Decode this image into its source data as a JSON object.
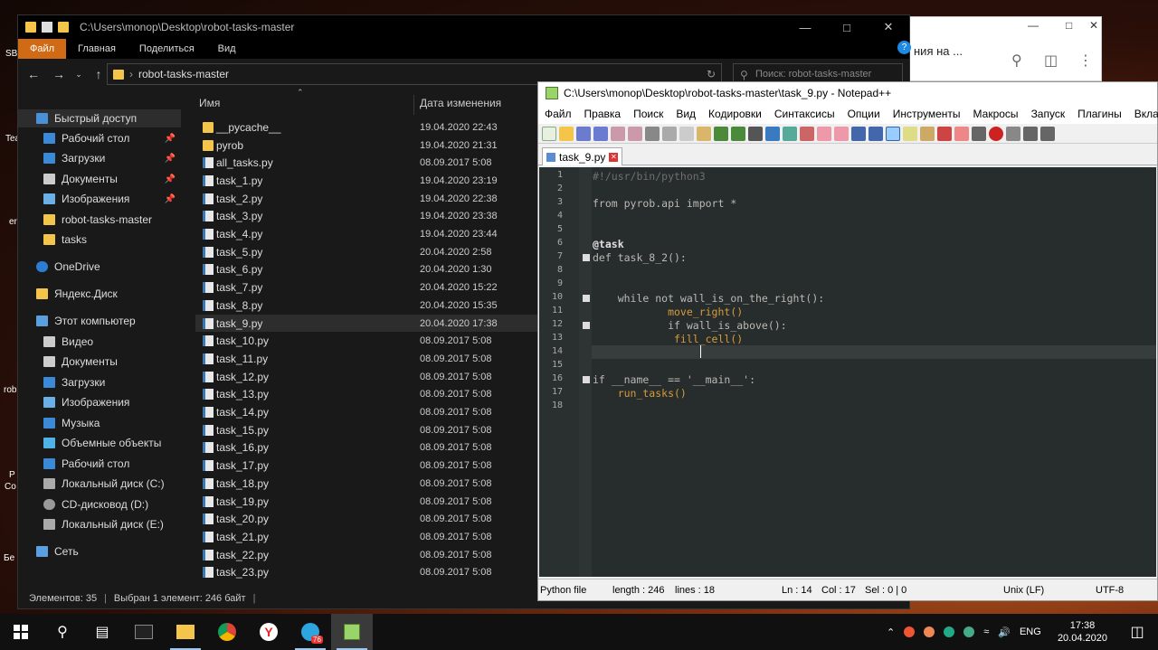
{
  "desktop": {
    "labels": [
      "SB",
      "Tea",
      "er",
      "rob",
      "P",
      "Co",
      "Бе"
    ]
  },
  "browser": {
    "title_fragment": "ния на ..."
  },
  "explorer": {
    "path": "C:\\Users\\monop\\Desktop\\robot-tasks-master",
    "ribbon_tabs": [
      "Файл",
      "Главная",
      "Поделиться",
      "Вид"
    ],
    "breadcrumb": "robot-tasks-master",
    "search_placeholder": "Поиск: robot-tasks-master",
    "nav_items": [
      {
        "label": "Быстрый доступ",
        "pinned": false
      },
      {
        "label": "Рабочий стол",
        "pinned": true
      },
      {
        "label": "Загрузки",
        "pinned": true
      },
      {
        "label": "Документы",
        "pinned": true
      },
      {
        "label": "Изображения",
        "pinned": true
      },
      {
        "label": "robot-tasks-master",
        "pinned": false
      },
      {
        "label": "tasks",
        "pinned": false
      },
      {
        "label": "OneDrive",
        "pinned": false
      },
      {
        "label": "Яндекс.Диск",
        "pinned": false
      },
      {
        "label": "Этот компьютер",
        "pinned": false
      },
      {
        "label": "Видео",
        "pinned": false
      },
      {
        "label": "Документы",
        "pinned": false
      },
      {
        "label": "Загрузки",
        "pinned": false
      },
      {
        "label": "Изображения",
        "pinned": false
      },
      {
        "label": "Музыка",
        "pinned": false
      },
      {
        "label": "Объемные объекты",
        "pinned": false
      },
      {
        "label": "Рабочий стол",
        "pinned": false
      },
      {
        "label": "Локальный диск (C:)",
        "pinned": false
      },
      {
        "label": "CD-дисковод (D:)",
        "pinned": false
      },
      {
        "label": "Локальный диск (E:)",
        "pinned": false
      },
      {
        "label": "Сеть",
        "pinned": false
      }
    ],
    "columns": {
      "name": "Имя",
      "date": "Дата изменения"
    },
    "files": [
      {
        "name": "__pycache__",
        "date": "19.04.2020 22:43",
        "type": "folder"
      },
      {
        "name": "pyrob",
        "date": "19.04.2020 21:31",
        "type": "folder"
      },
      {
        "name": "all_tasks.py",
        "date": "08.09.2017 5:08",
        "type": "py"
      },
      {
        "name": "task_1.py",
        "date": "19.04.2020 23:19",
        "type": "py"
      },
      {
        "name": "task_2.py",
        "date": "19.04.2020 22:38",
        "type": "py"
      },
      {
        "name": "task_3.py",
        "date": "19.04.2020 23:38",
        "type": "py"
      },
      {
        "name": "task_4.py",
        "date": "19.04.2020 23:44",
        "type": "py"
      },
      {
        "name": "task_5.py",
        "date": "20.04.2020 2:58",
        "type": "py"
      },
      {
        "name": "task_6.py",
        "date": "20.04.2020 1:30",
        "type": "py"
      },
      {
        "name": "task_7.py",
        "date": "20.04.2020 15:22",
        "type": "py"
      },
      {
        "name": "task_8.py",
        "date": "20.04.2020 15:35",
        "type": "py"
      },
      {
        "name": "task_9.py",
        "date": "20.04.2020 17:38",
        "type": "py",
        "selected": true
      },
      {
        "name": "task_10.py",
        "date": "08.09.2017 5:08",
        "type": "py"
      },
      {
        "name": "task_11.py",
        "date": "08.09.2017 5:08",
        "type": "py"
      },
      {
        "name": "task_12.py",
        "date": "08.09.2017 5:08",
        "type": "py"
      },
      {
        "name": "task_13.py",
        "date": "08.09.2017 5:08",
        "type": "py"
      },
      {
        "name": "task_14.py",
        "date": "08.09.2017 5:08",
        "type": "py"
      },
      {
        "name": "task_15.py",
        "date": "08.09.2017 5:08",
        "type": "py"
      },
      {
        "name": "task_16.py",
        "date": "08.09.2017 5:08",
        "type": "py"
      },
      {
        "name": "task_17.py",
        "date": "08.09.2017 5:08",
        "type": "py"
      },
      {
        "name": "task_18.py",
        "date": "08.09.2017 5:08",
        "type": "py"
      },
      {
        "name": "task_19.py",
        "date": "08.09.2017 5:08",
        "type": "py"
      },
      {
        "name": "task_20.py",
        "date": "08.09.2017 5:08",
        "type": "py"
      },
      {
        "name": "task_21.py",
        "date": "08.09.2017 5:08",
        "type": "py"
      },
      {
        "name": "task_22.py",
        "date": "08.09.2017 5:08",
        "type": "py"
      },
      {
        "name": "task_23.py",
        "date": "08.09.2017 5:08",
        "type": "py"
      }
    ],
    "status_items": "Элементов: 35",
    "status_selected": "Выбран 1 элемент: 246 байт"
  },
  "npp": {
    "title": "C:\\Users\\monop\\Desktop\\robot-tasks-master\\task_9.py - Notepad++",
    "menu": [
      "Файл",
      "Правка",
      "Поиск",
      "Вид",
      "Кодировки",
      "Синтаксисы",
      "Опции",
      "Инструменты",
      "Макросы",
      "Запуск",
      "Плагины",
      "Вкладки",
      "?"
    ],
    "tab": "task_9.py",
    "code_lines": [
      "#!/usr/bin/python3",
      "",
      "from pyrob.api import *",
      "",
      "",
      "@task",
      "def task_8_2():",
      "",
      "",
      "    while not wall_is_on_the_right():",
      "            move_right()",
      "            if wall_is_above():",
      "             fill_cell()",
      "",
      "",
      "if __name__ == '__main__':",
      "    run_tasks()",
      ""
    ],
    "status": {
      "type": "Python file",
      "length": "length : 246",
      "lines": "lines : 18",
      "ln": "Ln : 14",
      "col": "Col : 17",
      "sel": "Sel : 0 | 0",
      "eol": "Unix (LF)",
      "enc": "UTF-8"
    }
  },
  "taskbar": {
    "lang": "ENG",
    "time": "17:38",
    "date": "20.04.2020",
    "telegram_badge": "76",
    "apps": [
      "start-icon",
      "search-icon",
      "task-view-icon",
      "terminal-icon",
      "explorer-icon",
      "chrome-icon",
      "yandex-icon",
      "telegram-icon",
      "notepadpp-icon"
    ]
  }
}
